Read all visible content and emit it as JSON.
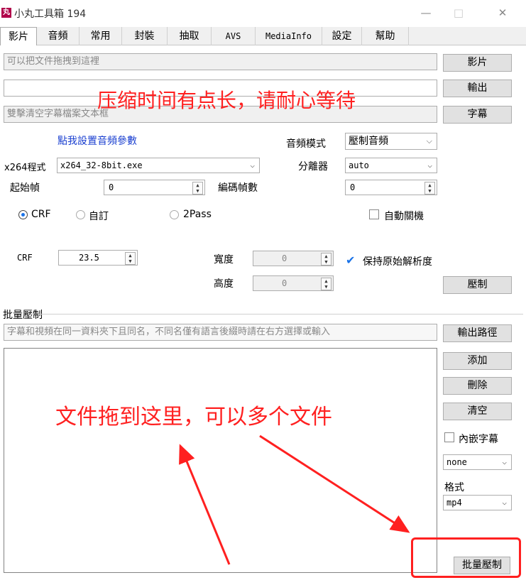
{
  "window": {
    "title": "小丸工具箱 194",
    "icon": "丸",
    "minimize_icon": "—",
    "maximize_icon": "□",
    "close_icon": "✕"
  },
  "tabs": [
    {
      "label": "影片"
    },
    {
      "label": "音頻"
    },
    {
      "label": "常用"
    },
    {
      "label": "封裝"
    },
    {
      "label": "抽取"
    },
    {
      "label": "AVS"
    },
    {
      "label": "MediaInfo"
    },
    {
      "label": "設定"
    },
    {
      "label": "幫助"
    }
  ],
  "video": {
    "input_placeholder": "可以把文件拖拽到這裡",
    "output_value": "",
    "subtitle_placeholder": "雙擊清空字幕檔案文本框",
    "btn_video": "影片",
    "btn_output": "輸出",
    "btn_subtitle": "字幕",
    "audio_settings_link": "點我設置音頻參數",
    "audio_mode_label": "音頻模式",
    "audio_mode_value": "壓制音頻",
    "x264_label": "x264程式",
    "x264_value": "x264_32-8bit.exe",
    "splitter_label": "分離器",
    "splitter_value": "auto",
    "start_frame_label": "起始幀",
    "start_frame_value": "0",
    "encode_frames_label": "編碼幀數",
    "encode_frames_value": "0",
    "mode_crf": "CRF",
    "mode_custom": "自訂",
    "mode_2pass": "2Pass",
    "auto_shutdown": "自動關機",
    "crf_label": "CRF",
    "crf_value": "23.5",
    "width_label": "寬度",
    "width_value": "0",
    "height_label": "高度",
    "height_value": "0",
    "keep_res_label": "保持原始解析度",
    "btn_encode": "壓制"
  },
  "batch": {
    "group_label": "批量壓制",
    "hint": "字幕和視頻在同一資料夾下且同名，不同名僅有語言後綴時請在右方選擇或輸入",
    "btn_output_path": "輸出路徑",
    "btn_add": "添加",
    "btn_delete": "刪除",
    "btn_clear": "清空",
    "embed_sub_label": "內嵌字幕",
    "sub_lang_value": "none",
    "format_label": "格式",
    "format_value": "mp4",
    "btn_batch_encode": "批量壓制"
  },
  "annotations": {
    "wait_note": "压缩时间有点长，请耐心等待",
    "drag_note": "文件拖到这里，可以多个文件",
    "color": "#ff2020"
  }
}
